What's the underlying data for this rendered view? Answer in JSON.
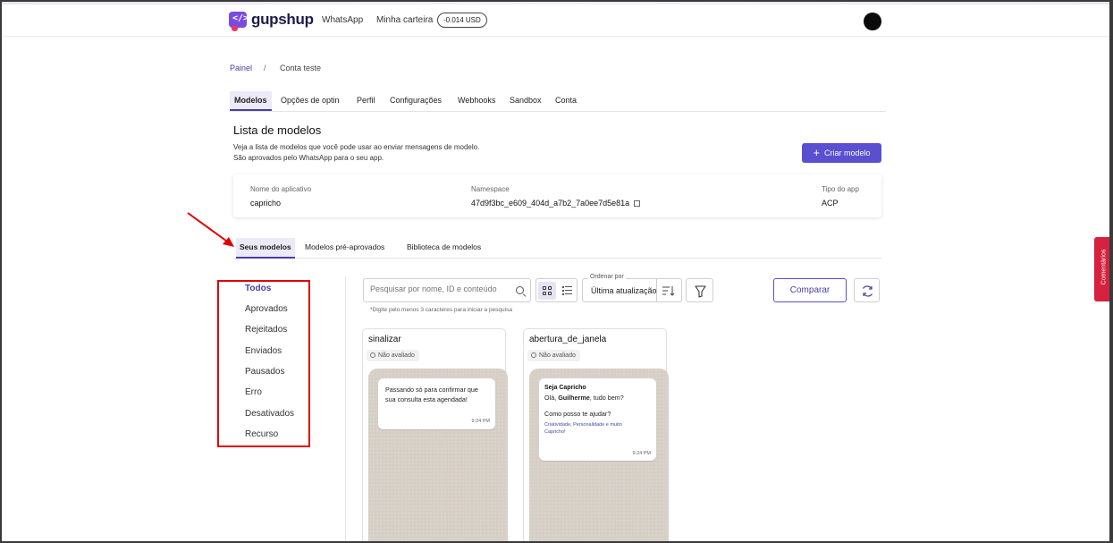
{
  "header": {
    "brand": "gupshup",
    "nav_whatsapp": "WhatsApp",
    "nav_wallet": "Minha carteira",
    "balance": "-0.014 USD"
  },
  "breadcrumb": {
    "root": "Painel",
    "separator": "/",
    "current": "Conta teste"
  },
  "tabs": [
    {
      "label": "Modelos",
      "active": true
    },
    {
      "label": "Opções de optin"
    },
    {
      "label": "Perfil"
    },
    {
      "label": "Configurações"
    },
    {
      "label": "Webhooks"
    },
    {
      "label": "Sandbox"
    },
    {
      "label": "Conta"
    }
  ],
  "page": {
    "title": "Lista de modelos",
    "desc_line1": "Veja a lista de modelos que você pode usar ao enviar mensagens de modelo.",
    "desc_line2": "São aprovados pelo WhatsApp para o seu app.",
    "create_label": "Criar modelo"
  },
  "app_info": {
    "app_name_label": "Nome do aplicativo",
    "app_name": "capricho",
    "namespace_label": "Namespace",
    "namespace": "47d9f3bc_e609_404d_a7b2_7a0ee7d5e81a",
    "type_label": "Tipo do app",
    "type": "ACP"
  },
  "subtabs": [
    {
      "label": "Seus modelos",
      "active": true
    },
    {
      "label": "Modelos pré-aprovados"
    },
    {
      "label": "Biblioteca de modelos"
    }
  ],
  "filters": [
    {
      "label": "Todos",
      "active": true
    },
    {
      "label": "Aprovados"
    },
    {
      "label": "Rejeitados"
    },
    {
      "label": "Enviados"
    },
    {
      "label": "Pausados"
    },
    {
      "label": "Erro"
    },
    {
      "label": "Desativados"
    },
    {
      "label": "Recurso"
    }
  ],
  "toolbar": {
    "search_placeholder": "Pesquisar por nome, ID e conteúdo",
    "search_hint": "*Digite pelo menos 3 caracteres para iniciar a pesquisa",
    "sort_label": "Ordenar por",
    "sort_value": "Última atualização",
    "compare_label": "Comparar"
  },
  "cards": [
    {
      "name": "sinalizar",
      "status": "Não avaliado",
      "message": "Passando só para confirmar que sua consulta esta agendada!",
      "time": "9:24 PM"
    },
    {
      "name": "abertura_de_janela",
      "status": "Não avaliado",
      "title": "Seja Capricho",
      "greeting_pre": "Olá, ",
      "greeting_name": "Guilherme",
      "greeting_post": ", tudo bem?",
      "question": "Como posso te ajudar?",
      "footer": "Criatividade, Personalidade e muito Capricho!",
      "time": "9:24 PM"
    }
  ],
  "feedback_label": "Comentários",
  "colors": {
    "accent": "#5b4ed0",
    "feedback": "#d6213f",
    "annotation": "#e00000"
  }
}
